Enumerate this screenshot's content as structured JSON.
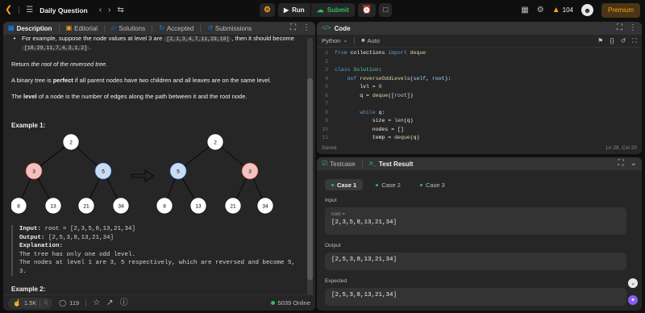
{
  "topbar": {
    "title": "Daily Question",
    "run_label": "Run",
    "submit_label": "Submit",
    "streak_count": "104",
    "premium_label": "Premium"
  },
  "tabs": {
    "description": "Description",
    "editorial": "Editorial",
    "solutions": "Solutions",
    "accepted": "Accepted",
    "submissions": "Submissions"
  },
  "desc": {
    "bullet_prefix": "For example, suppose the node values at level 3 are",
    "bullet_chip1": "[2,1,3,4,7,11,29,18]",
    "bullet_mid": ", then it should become",
    "bullet_chip2": "[18,29,11,7,4,3,1,2]",
    "return_pre": "Return",
    "return_em": "the root of the reversed tree",
    "return_post": ".",
    "perfect_pre": "A binary tree is",
    "perfect_bold": "perfect",
    "perfect_post": "if all parent nodes have two children and all leaves are on the same level.",
    "level_pre": "The",
    "level_bold": "level",
    "level_post": "of a node is the number of edges along the path between it and the root node.",
    "example1_title": "Example 1:",
    "example2_title": "Example 2:",
    "input_label": "Input:",
    "input_value": "root = [2,3,5,8,13,21,34]",
    "output_label": "Output:",
    "output_value": "[2,5,3,8,13,21,34]",
    "explanation_label": "Explanation:",
    "explanation_line1": "The tree has only one odd level.",
    "explanation_line2": "The nodes at level 1 are 3, 5 respectively, which are reversed and become 5, 3."
  },
  "trees": {
    "left": {
      "root": "2",
      "l1": [
        "3",
        "5"
      ],
      "l2": [
        "8",
        "13",
        "21",
        "34"
      ]
    },
    "right": {
      "root": "2",
      "l1": [
        "5",
        "3"
      ],
      "l2": [
        "8",
        "13",
        "21",
        "34"
      ]
    }
  },
  "footer": {
    "likes": "1.5K",
    "comments": "119",
    "online": "5039 Online"
  },
  "code": {
    "title": "Code",
    "language": "Python",
    "auto_label": "Auto",
    "status": "Saved",
    "cursor": "Ln 28, Col 20",
    "lines": [
      {
        "n": "1",
        "text": "from collections import deque"
      },
      {
        "n": "2",
        "text": ""
      },
      {
        "n": "3",
        "text": "class Solution:"
      },
      {
        "n": "4",
        "text": "    def reverseOddLevels(self, root):"
      },
      {
        "n": "5",
        "text": "        lvl = 0"
      },
      {
        "n": "6",
        "text": "        q = deque([root])"
      },
      {
        "n": "7",
        "text": ""
      },
      {
        "n": "8",
        "text": "        while q:"
      },
      {
        "n": "9",
        "text": "            size = len(q)"
      },
      {
        "n": "10",
        "text": "            nodes = []"
      },
      {
        "n": "11",
        "text": "            temp = deque(q)"
      }
    ]
  },
  "test": {
    "testcase_tab": "Testcase",
    "result_tab": "Test Result",
    "cases": [
      "Case 1",
      "Case 2",
      "Case 3"
    ],
    "input_label": "Input",
    "input_var": "root =",
    "input_value": "[2,3,5,8,13,21,34]",
    "output_label": "Output",
    "output_value": "[2,5,3,8,13,21,34]",
    "expected_label": "Expected",
    "expected_value": "[2,5,3,8,13,21,34]"
  },
  "colors": {
    "accent_orange": "#ffa116",
    "green": "#2cbb5d",
    "blue_tab": "#0a84ff",
    "node_red": "#f3c1c1",
    "node_blue": "#c9dcf3"
  }
}
